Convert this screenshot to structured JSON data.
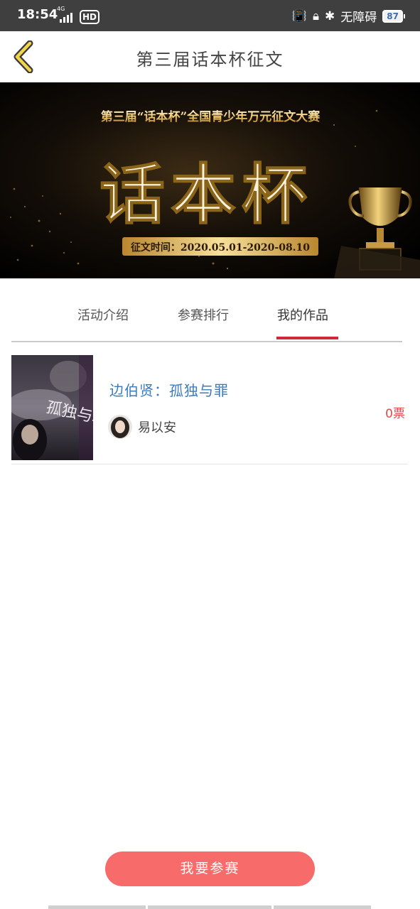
{
  "status_bar": {
    "time": "18:54",
    "network": "4G",
    "hd": "HD",
    "accessibility_text": "无障碍",
    "battery": "87"
  },
  "header": {
    "title": "第三届话本杯征文",
    "back_icon": "chevron-left-icon"
  },
  "banner": {
    "subtitle": "第三届“话本杯”全国青少年万元征文大赛",
    "logo_text": "话本杯",
    "period": "征文时间：2020.05.01-2020-08.10"
  },
  "tabs": [
    {
      "label": "活动介绍",
      "active": false
    },
    {
      "label": "参赛排行",
      "active": false
    },
    {
      "label": "我的作品",
      "active": true
    }
  ],
  "works": [
    {
      "title": "边伯贤：孤独与罪",
      "author": "易以安",
      "votes": "0票",
      "cover_text": "孤独与罪"
    }
  ],
  "join_button": "我要参赛",
  "colors": {
    "accent": "#d0283a",
    "button": "#f76b6b",
    "title_link": "#3b7bbd",
    "votes": "#e14a4a"
  }
}
